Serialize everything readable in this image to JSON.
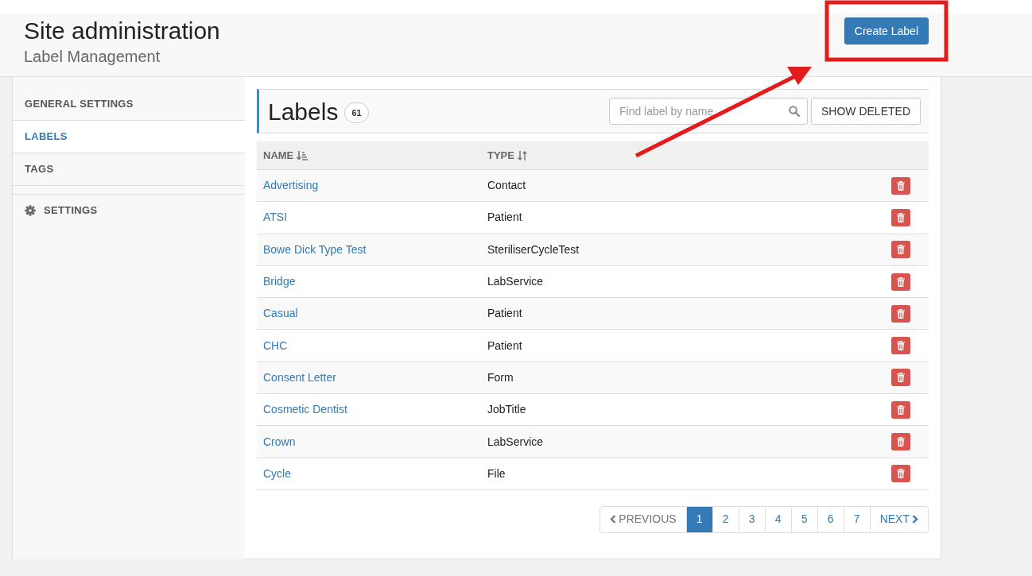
{
  "header": {
    "title": "Site administration",
    "subtitle": "Label Management",
    "create_button": "Create Label"
  },
  "sidebar": {
    "items": [
      {
        "label": "GENERAL SETTINGS",
        "selected": false,
        "kind": "plain"
      },
      {
        "label": "LABELS",
        "selected": true,
        "kind": "plain"
      },
      {
        "label": "TAGS",
        "selected": false,
        "kind": "plain"
      },
      {
        "label": "SETTINGS",
        "selected": false,
        "kind": "gear"
      }
    ]
  },
  "panel": {
    "title": "Labels",
    "count": "61",
    "search": {
      "placeholder": "Find label by name"
    },
    "show_deleted": "SHOW DELETED"
  },
  "table": {
    "columns": [
      {
        "label": "NAME",
        "kind": "alpha"
      },
      {
        "label": "TYPE",
        "kind": "both"
      }
    ],
    "rows": [
      {
        "name": "Advertising",
        "type": "Contact"
      },
      {
        "name": "ATSI",
        "type": "Patient"
      },
      {
        "name": "Bowe Dick Type Test",
        "type": "SteriliserCycleTest"
      },
      {
        "name": "Bridge",
        "type": "LabService"
      },
      {
        "name": "Casual",
        "type": "Patient"
      },
      {
        "name": "CHC",
        "type": "Patient"
      },
      {
        "name": "Consent Letter",
        "type": "Form"
      },
      {
        "name": "Cosmetic Dentist",
        "type": "JobTitle"
      },
      {
        "name": "Crown",
        "type": "LabService"
      },
      {
        "name": "Cycle",
        "type": "File"
      }
    ]
  },
  "pagination": {
    "previous": {
      "label": "PREVIOUS",
      "disabled": true
    },
    "pages": [
      {
        "label": "1",
        "selected": true
      },
      {
        "label": "2",
        "selected": false
      },
      {
        "label": "3",
        "selected": false
      },
      {
        "label": "4",
        "selected": false
      },
      {
        "label": "5",
        "selected": false
      },
      {
        "label": "6",
        "selected": false
      },
      {
        "label": "7",
        "selected": false
      }
    ],
    "next": {
      "label": "NEXT",
      "disabled": false
    }
  }
}
